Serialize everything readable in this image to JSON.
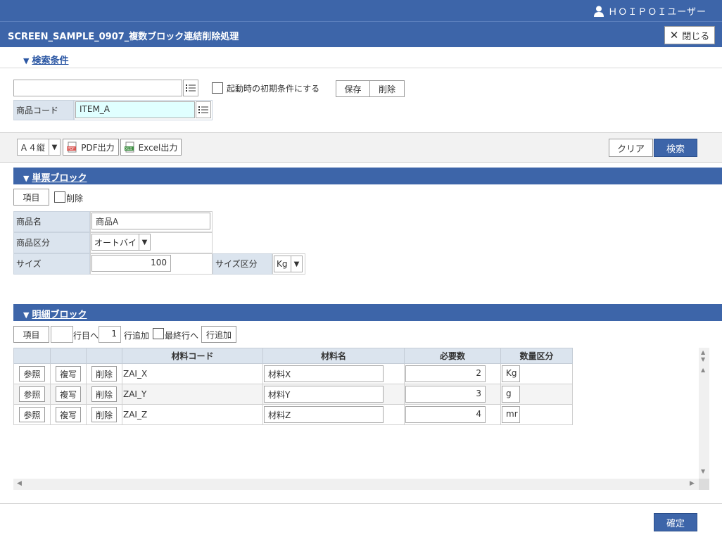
{
  "header": {
    "user_name": "ＨＯＩＰＯＩユーザー",
    "title": "SCREEN_SAMPLE_0907_複数ブロック連結削除処理",
    "close_label": "閉じる"
  },
  "search": {
    "section_label": "検索条件",
    "condition_value": "",
    "default_checkbox_label": "起動時の初期条件にする",
    "save_label": "保存",
    "delete_label": "削除",
    "product_code_label": "商品コード",
    "product_code_value": "ITEM_A"
  },
  "toolbar": {
    "paper_size": "Ａ４縦",
    "pdf_label": "PDF出力",
    "excel_label": "Excel出力",
    "clear_label": "クリア",
    "search_label": "検索"
  },
  "single_block": {
    "title": "単票ブロック",
    "item_button": "項目",
    "delete_label": "削除",
    "product_name_label": "商品名",
    "product_name_value": "商品A",
    "product_type_label": "商品区分",
    "product_type_value": "オートバイ",
    "size_label": "サイズ",
    "size_value": "100",
    "size_unit_label": "サイズ区分",
    "size_unit_value": "Kg"
  },
  "detail_block": {
    "title": "明細ブロック",
    "item_button": "項目",
    "row_to_value": "",
    "row_to_label": "行目へ",
    "add_count_value": "1",
    "add_row_label": "行追加",
    "last_row_label": "最終行へ",
    "add_row_button": "行追加",
    "columns": [
      "材料コード",
      "材料名",
      "必要数",
      "数量区分"
    ],
    "ref_label": "参照",
    "copy_label": "複写",
    "delete_label": "削除",
    "rows": [
      {
        "code": "ZAI_X",
        "name": "材料X",
        "qty": "2",
        "unit": "Kg"
      },
      {
        "code": "ZAI_Y",
        "name": "材料Y",
        "qty": "3",
        "unit": "g"
      },
      {
        "code": "ZAI_Z",
        "name": "材料Z",
        "qty": "4",
        "unit": "mr"
      }
    ]
  },
  "footer": {
    "confirm_label": "確定"
  },
  "colors": {
    "header_bg": "#3d65a9",
    "label_bg": "#dbe4ee",
    "highlight_input": "#e0ffff"
  }
}
